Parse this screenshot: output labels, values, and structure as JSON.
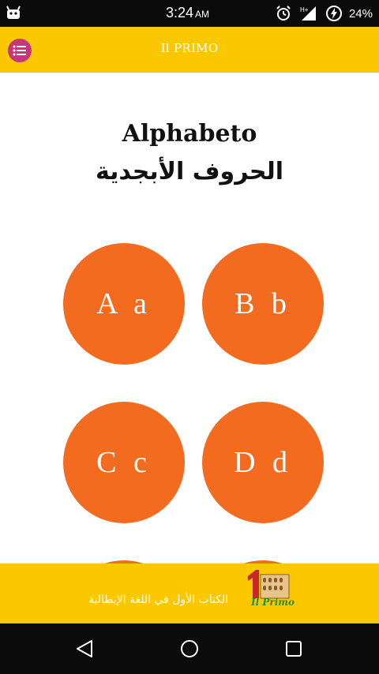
{
  "status_bar": {
    "time": "3:24",
    "ampm": "AM",
    "network": "H+",
    "battery": "24%"
  },
  "header": {
    "title": "Il PRIMO"
  },
  "page": {
    "title_latin": "Alphabeto",
    "title_arabic": "الحروف الأبجدية"
  },
  "letters": [
    "A a",
    "B b",
    "C c",
    "D d"
  ],
  "footer": {
    "caption": "الكتاب الأول في اللغة الإيطالية",
    "logo_text": "Il Primo"
  },
  "colors": {
    "header_bg": "#fbc800",
    "menu_button": "#c6367a",
    "letter_circle": "#f26b1f"
  }
}
